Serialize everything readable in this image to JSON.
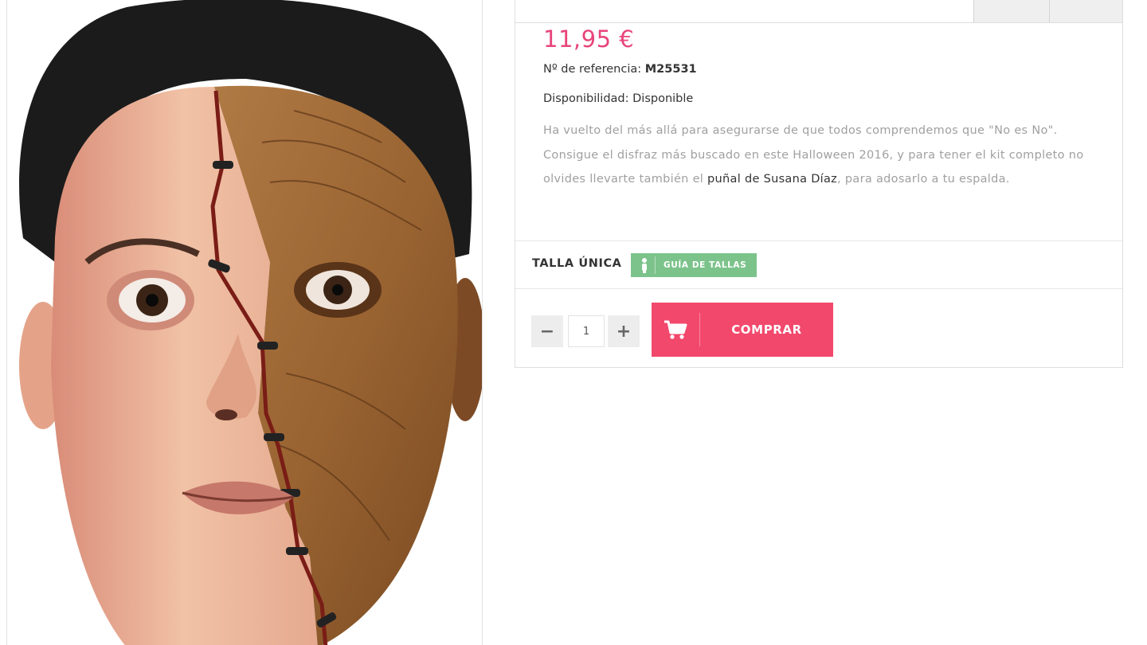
{
  "product": {
    "image_alt": "Halloween mask",
    "price": "11,95 €",
    "reference_label": "Nº de referencia:",
    "reference_value": "M25531",
    "availability": "Disponibilidad: Disponible",
    "description_part1": "Ha vuelto del más allá para asegurarse de que todos comprendemos que \"No es No\". Consigue el disfraz más buscado en este Halloween 2016, y para tener el kit completo no olvides llevarte también el ",
    "description_link": "puñal de Susana Díaz",
    "description_part2": ", para adosarlo a tu espalda."
  },
  "size": {
    "label": "TALLA ÚNICA",
    "guide_button": "GUÍA DE TALLAS",
    "guide_icon": "person-icon"
  },
  "purchase": {
    "minus_label": "−",
    "plus_label": "+",
    "quantity": "1",
    "buy_label": "COMPRAR",
    "buy_icon": "cart-icon"
  },
  "colors": {
    "price": "#e8457a",
    "buy_button": "#f2486c",
    "guide_button": "#7cc38b"
  }
}
